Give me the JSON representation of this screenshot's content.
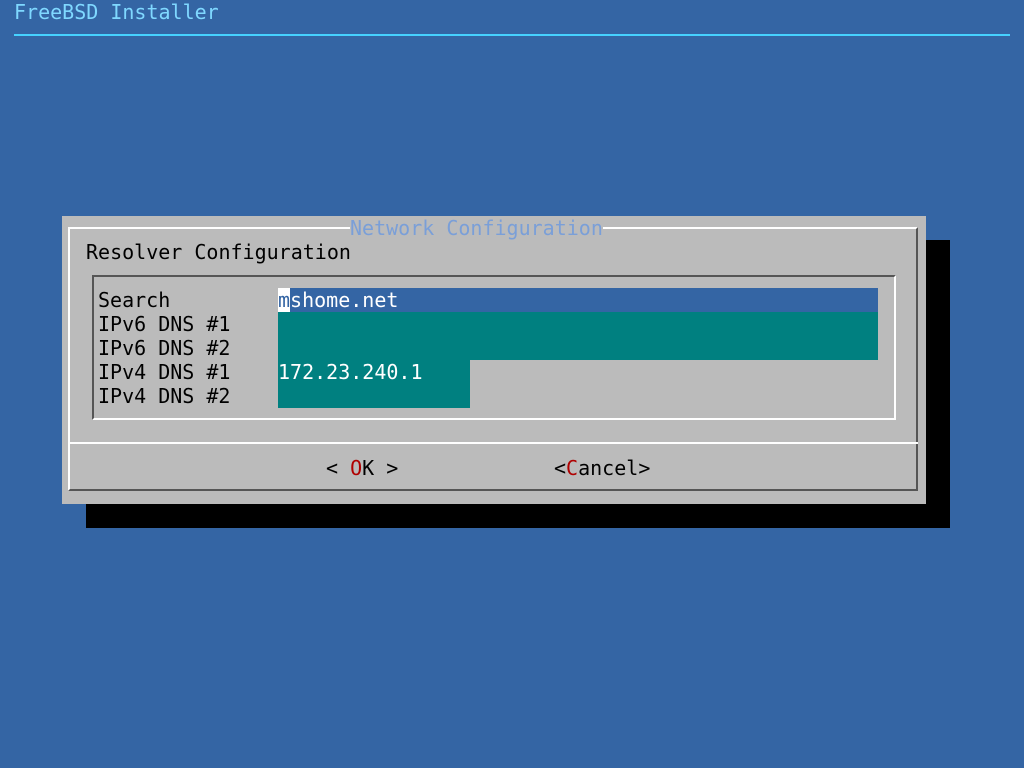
{
  "backtitle": "FreeBSD Installer",
  "dialog": {
    "title": "Network Configuration",
    "prompt": "Resolver Configuration"
  },
  "form": {
    "fields": [
      {
        "label": "Search",
        "value": "mshome.net",
        "active": true
      },
      {
        "label": "IPv6 DNS #1",
        "value": ""
      },
      {
        "label": "IPv6 DNS #2",
        "value": ""
      },
      {
        "label": "IPv4 DNS #1",
        "value": "172.23.240.1"
      },
      {
        "label": "IPv4 DNS #2",
        "value": ""
      }
    ]
  },
  "buttons": {
    "ok": {
      "left": "<",
      "hotkey": "O",
      "rest": "K",
      "right": ">"
    },
    "cancel": {
      "left": "<",
      "hotkey": "C",
      "rest": "ancel",
      "right": ">"
    }
  },
  "colors": {
    "background": "#3465a4",
    "dialog": "#bbbbbb",
    "field": "#008080",
    "active_field": "#3465a4",
    "hotkey": "#b00000",
    "backtitle": "#7fd8ff"
  }
}
